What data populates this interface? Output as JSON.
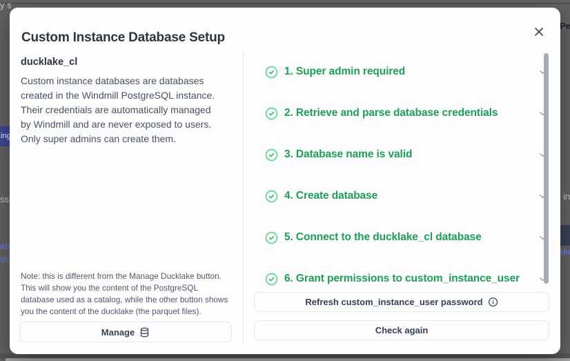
{
  "modal": {
    "title": "Custom Instance Database Setup",
    "left": {
      "heading": "ducklake_cl",
      "description": "Custom instance databases are databases\ncreated in the Windmill PostgreSQL instance.\nTheir credentials are automatically managed\nby Windmill and are never exposed to users.\nOnly super admins can create them.",
      "note": "Note: this is different from the Manage Ducklake button.\nThis will show you the content of the PostgreSQL\ndatabase used as a catalog, while the other button shows\nyou the content of the ducklake (the parquet files).",
      "manage_button_label": "Manage"
    },
    "right": {
      "steps": [
        {
          "label": "1. Super admin required",
          "status": "success"
        },
        {
          "label": "2. Retrieve and parse database credentials",
          "status": "success"
        },
        {
          "label": "3. Database name is valid",
          "status": "success"
        },
        {
          "label": "4. Create database",
          "status": "success"
        },
        {
          "label": "5. Connect to the ducklake_cl database",
          "status": "success"
        },
        {
          "label": "6. Grant permissions to custom_instance_user",
          "status": "success"
        }
      ],
      "refresh_button_label": "Refresh custom_instance_user password",
      "check_again_button_label": "Check again"
    }
  },
  "background": {
    "fragments": [
      {
        "text": "y s"
      },
      {
        "text": "ing"
      },
      {
        "text": "ss"
      },
      {
        "text": "ata"
      },
      {
        "text": "sta"
      },
      {
        "text": "Pe"
      },
      {
        "text": "s in"
      },
      {
        "text": "ake"
      }
    ]
  },
  "colors": {
    "step_text_green": "#1aa154",
    "check_circle_green": "#4ade80",
    "check_mark_green": "#2fbe66",
    "title_dark": "#2b3544",
    "body_text": "#465263",
    "button_border": "#e4e7ec",
    "selected_nav_indigo": "#3b4795",
    "link_blue": "#5f76d8",
    "overlay_gray": "#616161"
  },
  "icons": {
    "close": "x-icon",
    "step_status": "circle-check-icon",
    "step_expand": "chevron-down-icon",
    "manage": "database-icon",
    "refresh_info": "info-icon"
  }
}
